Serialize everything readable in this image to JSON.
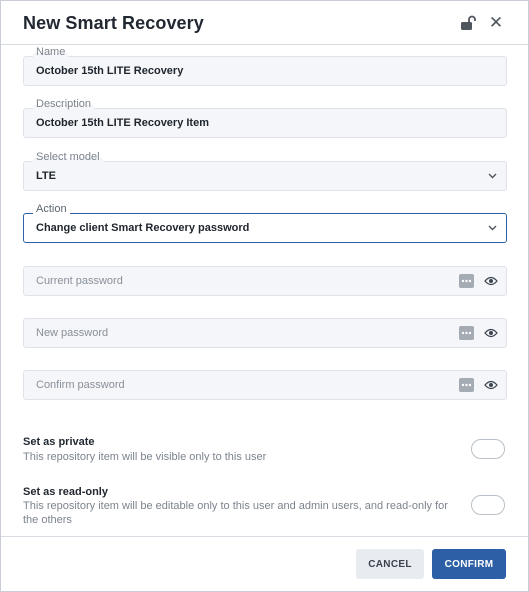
{
  "dialog": {
    "title": "New Smart Recovery",
    "icons": {
      "lock": "unlock-icon",
      "close": "close-icon",
      "close_glyph": "✕"
    }
  },
  "form": {
    "name": {
      "label": "Name",
      "value": "October 15th LITE Recovery"
    },
    "description": {
      "label": "Description",
      "value": "October 15th LITE Recovery Item"
    },
    "model": {
      "label": "Select model",
      "value": "LTE"
    },
    "action": {
      "label": "Action",
      "value": "Change client Smart Recovery password"
    },
    "current_password": {
      "placeholder": "Current password"
    },
    "new_password": {
      "placeholder": "New password"
    },
    "confirm_password": {
      "placeholder": "Confirm password"
    }
  },
  "toggles": {
    "private": {
      "title": "Set as private",
      "description": "This repository item will be visible only to this user",
      "enabled": false
    },
    "readonly": {
      "title": "Set as read-only",
      "description": "This repository item will be editable only to this user and admin users, and read-only for the others",
      "enabled": false
    }
  },
  "buttons": {
    "cancel": "CANCEL",
    "confirm": "CONFIRM"
  },
  "colors": {
    "accent": "#2c5fa5",
    "focus_border": "#2f5fa8",
    "field_bg": "#f4f6f9"
  }
}
